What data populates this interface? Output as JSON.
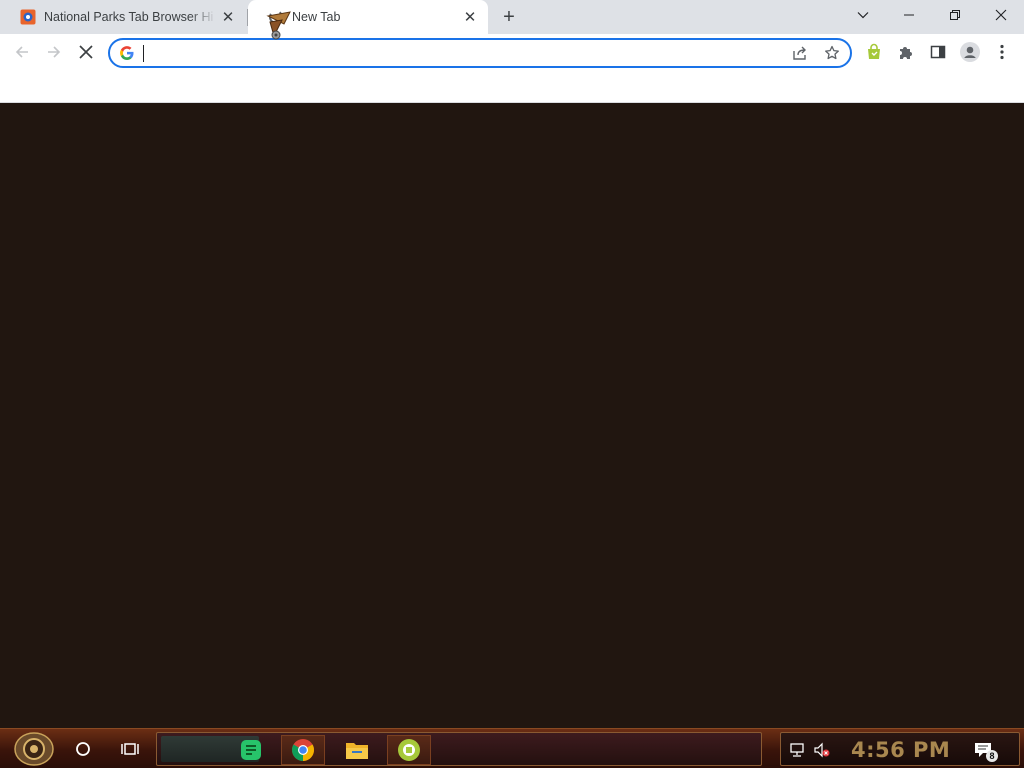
{
  "browser": {
    "tabs": [
      {
        "title": "National Parks Tab Browser Hi",
        "close_glyph": "✕",
        "favicon": "national-parks-favicon"
      },
      {
        "title": "New Tab",
        "close_glyph": "✕",
        "favicon": "chrome-newtab-favicon"
      }
    ],
    "new_tab_glyph": "+",
    "window_controls": [
      "chevron-down-icon",
      "minimize-icon",
      "restore-icon",
      "close-icon"
    ],
    "omnibox": {
      "value": "",
      "placeholder": ""
    },
    "loading": true,
    "accent_color": "#1a73e8",
    "content_background": "#211610"
  },
  "taskbar": {
    "pinned_apps": [
      "spotify-icon",
      "chrome-icon",
      "file-explorer-icon",
      "app-icon"
    ],
    "clock": "4:56 PM",
    "notification_count": "8",
    "clock_color": "#a9874f"
  }
}
